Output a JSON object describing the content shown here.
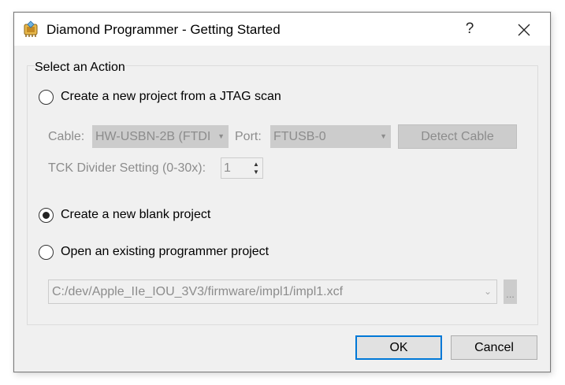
{
  "window": {
    "title": "Diamond Programmer - Getting Started",
    "help_label": "?",
    "icons": {
      "app": "diamond-programmer-icon",
      "close": "close-icon"
    }
  },
  "group": {
    "legend": "Select an Action"
  },
  "options": {
    "jtag_scan": {
      "label": "Create a new project from a JTAG scan",
      "selected": false
    },
    "blank_project": {
      "label": "Create a new blank project",
      "selected": true
    },
    "open_existing": {
      "label": "Open an existing programmer project",
      "selected": false
    }
  },
  "jtag": {
    "cable_label": "Cable:",
    "cable_value": "HW-USBN-2B (FTDI",
    "port_label": "Port:",
    "port_value": "FTUSB-0",
    "detect_label": "Detect Cable",
    "tck_label": "TCK Divider Setting (0-30x):",
    "tck_value": "1"
  },
  "existing": {
    "path_value": "C:/dev/Apple_IIe_IOU_3V3/firmware/impl1/impl1.xcf",
    "browse_label": "..."
  },
  "footer": {
    "ok_label": "OK",
    "cancel_label": "Cancel"
  }
}
